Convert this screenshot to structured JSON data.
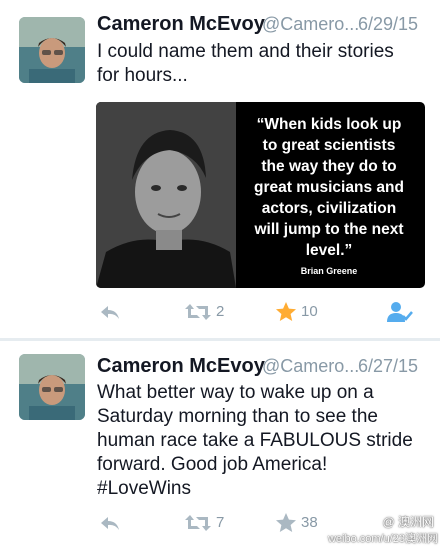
{
  "colors": {
    "accent": "#55acee",
    "star": "#ffac33",
    "muted": "#8899a6",
    "text": "#141823",
    "separator": "#e6ecf0"
  },
  "tweets": [
    {
      "name": "Cameron McEvoy",
      "handle": "@Camero...",
      "time": "6/29/15",
      "text_lines": [
        "I could name them and their stories",
        "for hours..."
      ],
      "media": {
        "quote_lines": [
          "“When kids look up",
          "to great scientists",
          "the way they do to",
          "great musicians and",
          "actors, civilization",
          "will jump to the next",
          "level.”"
        ],
        "attribution": "Brian Greene"
      },
      "retweets": "2",
      "favorites": "10"
    },
    {
      "name": "Cameron McEvoy",
      "handle": "@Camero...",
      "time": "6/27/15",
      "text_lines": [
        "What better way to wake up on a",
        "Saturday morning than to see the",
        "human race take a FABULOUS stride",
        "forward. Good job America!",
        "#LoveWins"
      ],
      "retweets": "7",
      "favorites": "38"
    }
  ],
  "watermark": {
    "line1": "@ 澳洲网",
    "line2": "weibo.com/u/23澳洲网"
  },
  "icons": [
    "reply-icon",
    "retweet-icon",
    "star-icon",
    "follow-user-icon"
  ]
}
